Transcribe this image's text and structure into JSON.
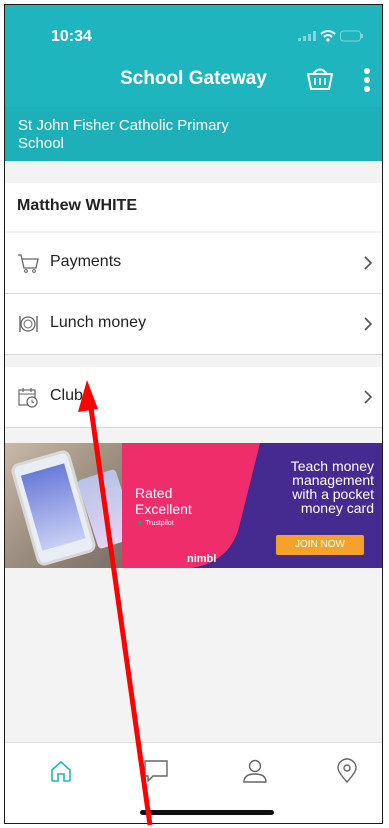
{
  "status_bar": {
    "time": "10:34"
  },
  "header": {
    "title": "School Gateway",
    "basket_icon": "basket-icon",
    "more_icon": "kebab-menu-icon"
  },
  "school": {
    "name": "St John Fisher Catholic Primary School"
  },
  "student": {
    "name": "Matthew WHITE"
  },
  "menu": [
    {
      "label": "Payments",
      "icon": "cart-icon"
    },
    {
      "label": "Lunch money",
      "icon": "cutlery-icon"
    },
    {
      "label": "Clubs",
      "icon": "calendar-clock-icon"
    }
  ],
  "banner": {
    "rated_line1": "Rated",
    "rated_line2": "Excellent",
    "trustpilot": "Trustpilot",
    "brand": "nimbl",
    "tagline_line1": "Teach money",
    "tagline_line2": "management",
    "tagline_line3": "with a pocket",
    "tagline_line4": "money card",
    "join_label": "JOIN NOW"
  },
  "bottom_nav": [
    "home-icon",
    "chat-icon",
    "user-icon",
    "location-pin-icon"
  ],
  "colors": {
    "header": "#1fb5be",
    "banner": "#452a8f",
    "pink": "#ef2d6b",
    "join": "#f4a22a",
    "annotation_arrow": "#ff0000"
  }
}
